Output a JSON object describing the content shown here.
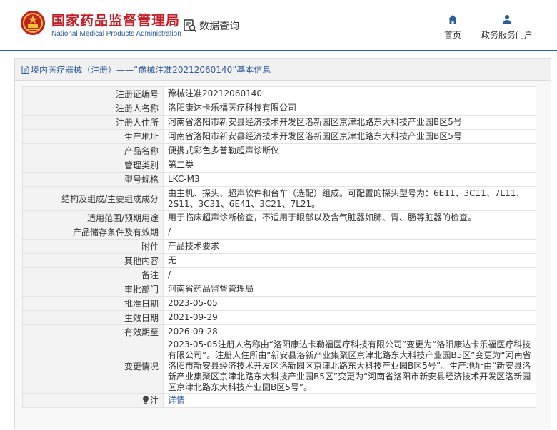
{
  "header": {
    "org_name_cn": "国家药品监督管理局",
    "org_name_en": "National Medical Products Administration",
    "search_label": "数据查询",
    "nav": [
      {
        "label": "首页",
        "icon": "home-icon"
      },
      {
        "label": "政务服务门户",
        "icon": "user-icon"
      }
    ]
  },
  "colors": {
    "brand_red": "#c01f25",
    "brand_blue": "#2b5c9e"
  },
  "panel": {
    "title": "境内医疗器械（注册）——“豫械注准20212060140”基本信息"
  },
  "detail": {
    "rows": [
      {
        "label": "注册证编号",
        "value": "豫械注准20212060140"
      },
      {
        "label": "注册人名称",
        "value": "洛阳康达卡乐福医疗科技有限公司"
      },
      {
        "label": "注册人住所",
        "value": "河南省洛阳市新安县经济技术开发区洛新园区京津北路东大科技产业园B区5号"
      },
      {
        "label": "生产地址",
        "value": "河南省洛阳市新安县经济技术开发区洛新园区京津北路东大科技产业园B区5号"
      },
      {
        "label": "产品名称",
        "value": "便携式彩色多普勒超声诊断仪"
      },
      {
        "label": "管理类别",
        "value": "第二类"
      },
      {
        "label": "型号规格",
        "value": "LKC-M3"
      },
      {
        "label": "结构及组成/主要组成成分",
        "value": "由主机、探头、超声软件和台车（选配）组成。可配置的探头型号为：6E11、3C11、7L11、2S11、3C31、6E41、3C21、7L21。"
      },
      {
        "label": "适用范围/预期用途",
        "value": "用于临床超声诊断检查，不适用于眼部以及含气脏器如肺、胃、肠等脏器的检查。"
      },
      {
        "label": "产品储存条件及有效期",
        "value": "/"
      },
      {
        "label": "附件",
        "value": "产品技术要求"
      },
      {
        "label": "其他内容",
        "value": "无"
      },
      {
        "label": "备注",
        "value": "/"
      },
      {
        "label": "审批部门",
        "value": "河南省药品监督管理局"
      },
      {
        "label": "批准日期",
        "value": "2023-05-05"
      },
      {
        "label": "生效日期",
        "value": "2021-09-29"
      },
      {
        "label": "有效期至",
        "value": "2026-09-28"
      },
      {
        "label": "变更情况",
        "value": "2023-05-05注册人名称由“洛阳康达卡勒福医疗科技有限公司”变更为“洛阳康达卡乐福医疗科技有限公司”。注册人住所由“新安县洛新产业集聚区京津北路东大科技产业园B5区”变更为“河南省洛阳市新安县经济技术开发区洛新园区京津北路东大科技产业园B区5号”。生产地址由“新安县洛新产业集聚区京津北路东大科技产业园B5区”变更为“河南省洛阳市新安县经济技术开发区洛新园区京津北路东大科技产业园B区5号”。"
      },
      {
        "label": "注",
        "value": "详情"
      }
    ]
  }
}
